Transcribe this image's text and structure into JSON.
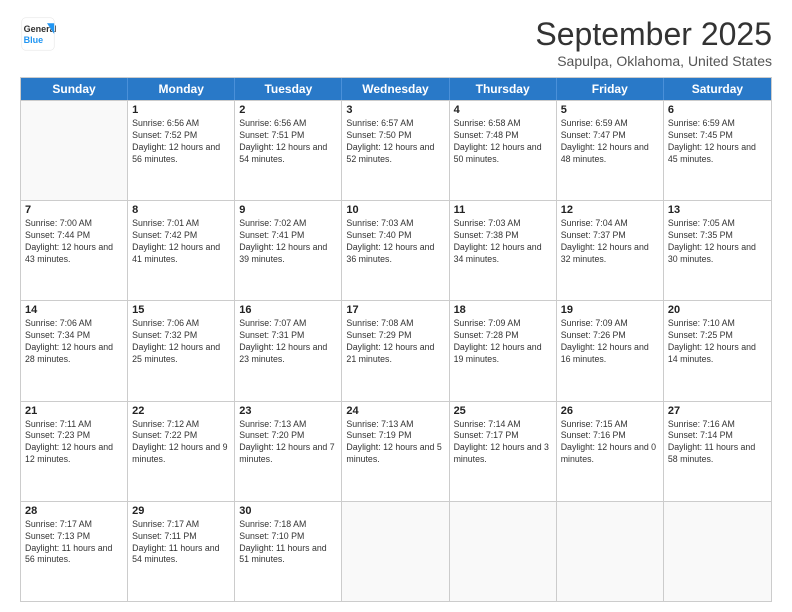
{
  "header": {
    "logo_line1": "General",
    "logo_line2": "Blue",
    "month_title": "September 2025",
    "location": "Sapulpa, Oklahoma, United States"
  },
  "days_of_week": [
    "Sunday",
    "Monday",
    "Tuesday",
    "Wednesday",
    "Thursday",
    "Friday",
    "Saturday"
  ],
  "rows": [
    [
      {
        "day": "",
        "empty": true
      },
      {
        "day": "1",
        "sunrise": "Sunrise: 6:56 AM",
        "sunset": "Sunset: 7:52 PM",
        "daylight": "Daylight: 12 hours and 56 minutes."
      },
      {
        "day": "2",
        "sunrise": "Sunrise: 6:56 AM",
        "sunset": "Sunset: 7:51 PM",
        "daylight": "Daylight: 12 hours and 54 minutes."
      },
      {
        "day": "3",
        "sunrise": "Sunrise: 6:57 AM",
        "sunset": "Sunset: 7:50 PM",
        "daylight": "Daylight: 12 hours and 52 minutes."
      },
      {
        "day": "4",
        "sunrise": "Sunrise: 6:58 AM",
        "sunset": "Sunset: 7:48 PM",
        "daylight": "Daylight: 12 hours and 50 minutes."
      },
      {
        "day": "5",
        "sunrise": "Sunrise: 6:59 AM",
        "sunset": "Sunset: 7:47 PM",
        "daylight": "Daylight: 12 hours and 48 minutes."
      },
      {
        "day": "6",
        "sunrise": "Sunrise: 6:59 AM",
        "sunset": "Sunset: 7:45 PM",
        "daylight": "Daylight: 12 hours and 45 minutes."
      }
    ],
    [
      {
        "day": "7",
        "sunrise": "Sunrise: 7:00 AM",
        "sunset": "Sunset: 7:44 PM",
        "daylight": "Daylight: 12 hours and 43 minutes."
      },
      {
        "day": "8",
        "sunrise": "Sunrise: 7:01 AM",
        "sunset": "Sunset: 7:42 PM",
        "daylight": "Daylight: 12 hours and 41 minutes."
      },
      {
        "day": "9",
        "sunrise": "Sunrise: 7:02 AM",
        "sunset": "Sunset: 7:41 PM",
        "daylight": "Daylight: 12 hours and 39 minutes."
      },
      {
        "day": "10",
        "sunrise": "Sunrise: 7:03 AM",
        "sunset": "Sunset: 7:40 PM",
        "daylight": "Daylight: 12 hours and 36 minutes."
      },
      {
        "day": "11",
        "sunrise": "Sunrise: 7:03 AM",
        "sunset": "Sunset: 7:38 PM",
        "daylight": "Daylight: 12 hours and 34 minutes."
      },
      {
        "day": "12",
        "sunrise": "Sunrise: 7:04 AM",
        "sunset": "Sunset: 7:37 PM",
        "daylight": "Daylight: 12 hours and 32 minutes."
      },
      {
        "day": "13",
        "sunrise": "Sunrise: 7:05 AM",
        "sunset": "Sunset: 7:35 PM",
        "daylight": "Daylight: 12 hours and 30 minutes."
      }
    ],
    [
      {
        "day": "14",
        "sunrise": "Sunrise: 7:06 AM",
        "sunset": "Sunset: 7:34 PM",
        "daylight": "Daylight: 12 hours and 28 minutes."
      },
      {
        "day": "15",
        "sunrise": "Sunrise: 7:06 AM",
        "sunset": "Sunset: 7:32 PM",
        "daylight": "Daylight: 12 hours and 25 minutes."
      },
      {
        "day": "16",
        "sunrise": "Sunrise: 7:07 AM",
        "sunset": "Sunset: 7:31 PM",
        "daylight": "Daylight: 12 hours and 23 minutes."
      },
      {
        "day": "17",
        "sunrise": "Sunrise: 7:08 AM",
        "sunset": "Sunset: 7:29 PM",
        "daylight": "Daylight: 12 hours and 21 minutes."
      },
      {
        "day": "18",
        "sunrise": "Sunrise: 7:09 AM",
        "sunset": "Sunset: 7:28 PM",
        "daylight": "Daylight: 12 hours and 19 minutes."
      },
      {
        "day": "19",
        "sunrise": "Sunrise: 7:09 AM",
        "sunset": "Sunset: 7:26 PM",
        "daylight": "Daylight: 12 hours and 16 minutes."
      },
      {
        "day": "20",
        "sunrise": "Sunrise: 7:10 AM",
        "sunset": "Sunset: 7:25 PM",
        "daylight": "Daylight: 12 hours and 14 minutes."
      }
    ],
    [
      {
        "day": "21",
        "sunrise": "Sunrise: 7:11 AM",
        "sunset": "Sunset: 7:23 PM",
        "daylight": "Daylight: 12 hours and 12 minutes."
      },
      {
        "day": "22",
        "sunrise": "Sunrise: 7:12 AM",
        "sunset": "Sunset: 7:22 PM",
        "daylight": "Daylight: 12 hours and 9 minutes."
      },
      {
        "day": "23",
        "sunrise": "Sunrise: 7:13 AM",
        "sunset": "Sunset: 7:20 PM",
        "daylight": "Daylight: 12 hours and 7 minutes."
      },
      {
        "day": "24",
        "sunrise": "Sunrise: 7:13 AM",
        "sunset": "Sunset: 7:19 PM",
        "daylight": "Daylight: 12 hours and 5 minutes."
      },
      {
        "day": "25",
        "sunrise": "Sunrise: 7:14 AM",
        "sunset": "Sunset: 7:17 PM",
        "daylight": "Daylight: 12 hours and 3 minutes."
      },
      {
        "day": "26",
        "sunrise": "Sunrise: 7:15 AM",
        "sunset": "Sunset: 7:16 PM",
        "daylight": "Daylight: 12 hours and 0 minutes."
      },
      {
        "day": "27",
        "sunrise": "Sunrise: 7:16 AM",
        "sunset": "Sunset: 7:14 PM",
        "daylight": "Daylight: 11 hours and 58 minutes."
      }
    ],
    [
      {
        "day": "28",
        "sunrise": "Sunrise: 7:17 AM",
        "sunset": "Sunset: 7:13 PM",
        "daylight": "Daylight: 11 hours and 56 minutes."
      },
      {
        "day": "29",
        "sunrise": "Sunrise: 7:17 AM",
        "sunset": "Sunset: 7:11 PM",
        "daylight": "Daylight: 11 hours and 54 minutes."
      },
      {
        "day": "30",
        "sunrise": "Sunrise: 7:18 AM",
        "sunset": "Sunset: 7:10 PM",
        "daylight": "Daylight: 11 hours and 51 minutes."
      },
      {
        "day": "",
        "empty": true
      },
      {
        "day": "",
        "empty": true
      },
      {
        "day": "",
        "empty": true
      },
      {
        "day": "",
        "empty": true
      }
    ]
  ]
}
